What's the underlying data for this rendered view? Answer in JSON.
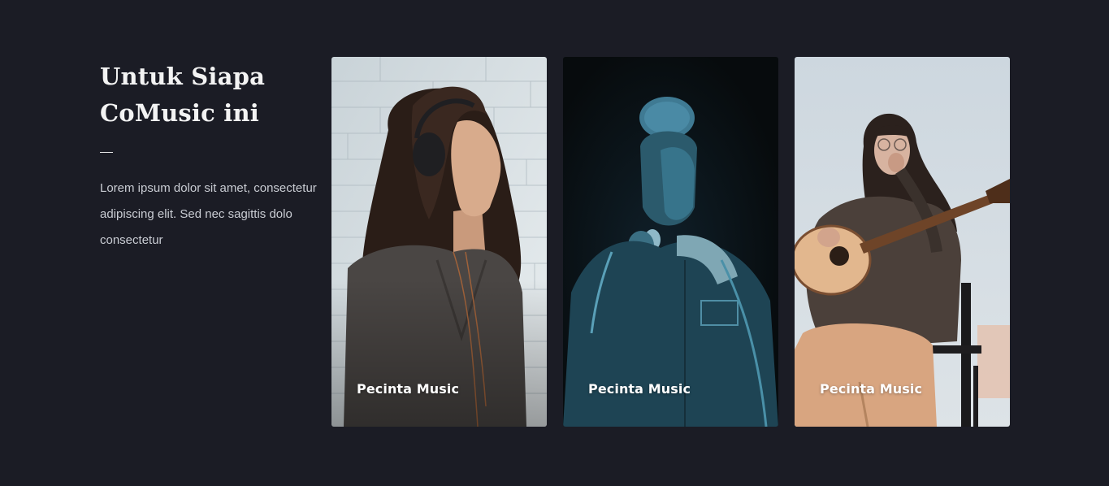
{
  "intro": {
    "title_line1": "Untuk Siapa",
    "title_line2": "CoMusic ini",
    "description": "Lorem ipsum dolor sit amet, consectetur adipiscing elit. Sed nec sagittis dolo consectetur"
  },
  "cards": [
    {
      "label": "Pecinta Music",
      "photo": "woman with headphones against white brick wall"
    },
    {
      "label": "Pecinta Music",
      "photo": "singer with microphone in blue light"
    },
    {
      "label": "Pecinta Music",
      "photo": "woman playing acoustic guitar on chair"
    }
  ],
  "colors": {
    "background": "#1b1c25",
    "title": "#f3f3f3",
    "body_text": "#c9ccd3"
  }
}
